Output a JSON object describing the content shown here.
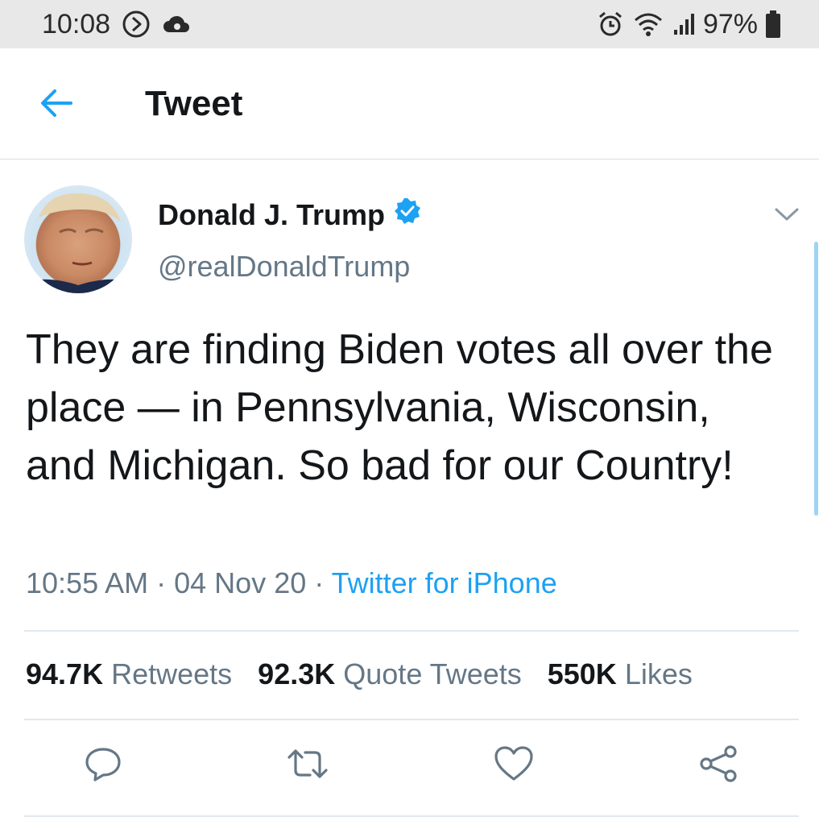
{
  "status_bar": {
    "time": "10:08",
    "battery": "97%",
    "icons": [
      "play-circle-icon",
      "cloud-icon",
      "alarm-icon",
      "wifi-icon",
      "signal-icon",
      "battery-icon"
    ]
  },
  "header": {
    "title": "Tweet",
    "back_icon": "arrow-left-icon"
  },
  "tweet": {
    "author_name": "Donald J. Trump",
    "verified": true,
    "handle": "@realDonaldTrump",
    "text": "They are finding Biden votes all over the place — in Pennsylvania, Wisconsin, and Michigan. So bad for our Country!",
    "time": "10:55 AM",
    "separator": "·",
    "date": "04 Nov 20",
    "source": "Twitter for iPhone",
    "stats": {
      "retweets_count": "94.7K",
      "retweets_label": "Retweets",
      "quotes_count": "92.3K",
      "quotes_label": "Quote Tweets",
      "likes_count": "550K",
      "likes_label": "Likes"
    },
    "actions": [
      "reply-icon",
      "retweet-icon",
      "like-icon",
      "share-icon"
    ]
  },
  "colors": {
    "accent": "#1da1f2",
    "secondary_text": "#657786",
    "primary_text": "#14171a",
    "divider": "#e1e8ed",
    "status_bar_bg": "#e8e8e8"
  }
}
